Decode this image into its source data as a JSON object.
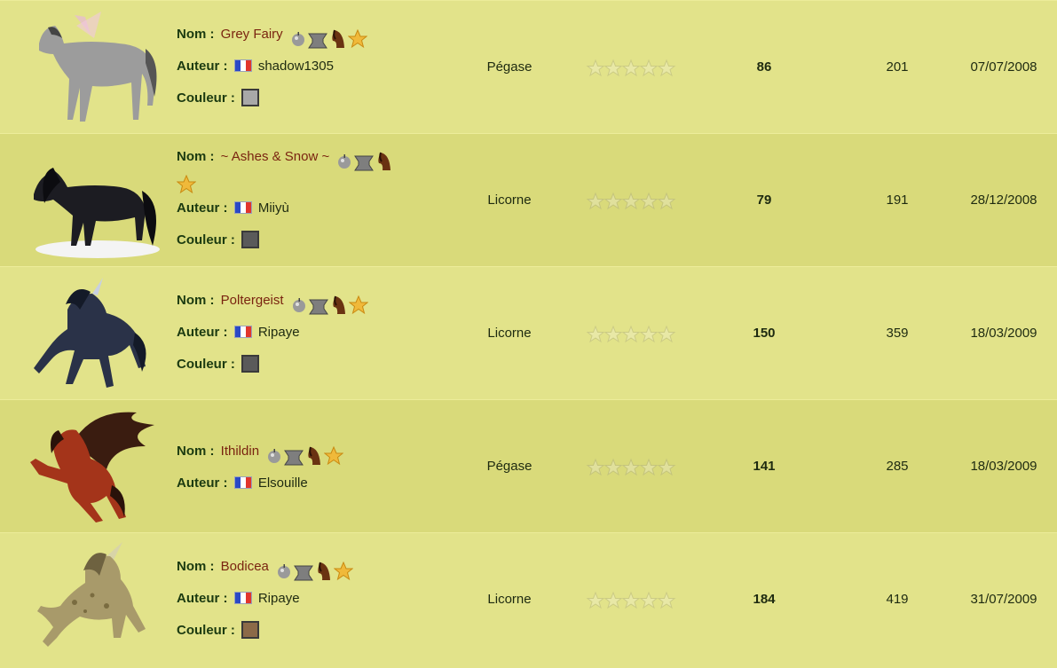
{
  "labels": {
    "name": "Nom :",
    "author": "Auteur :",
    "color": "Couleur :"
  },
  "badges": [
    "apple-icon",
    "anvil-icon",
    "horse-head-icon",
    "star-icon"
  ],
  "rating_icon": "empty-star-icon",
  "colors": {
    "name_text": "#7a2410",
    "label_text": "#1b3a10",
    "row_light": "#e2e38a",
    "row_dark": "#d9da7a"
  },
  "rows": [
    {
      "name": "Grey Fairy",
      "author": "shadow1305",
      "author_flag": "france-flag-icon",
      "color_swatch": "#a8a8a8",
      "type": "Pégase",
      "rating_stars": 0,
      "score": "86",
      "views": "201",
      "date": "07/07/2008",
      "image": "grey-fairy-horse-image"
    },
    {
      "name": "~ Ashes & Snow ~",
      "author": "Miiyù",
      "author_flag": "france-flag-icon",
      "color_swatch": "#5a5a5a",
      "type": "Licorne",
      "rating_stars": 0,
      "score": "79",
      "views": "191",
      "date": "28/12/2008",
      "image": "black-horse-on-snow-image"
    },
    {
      "name": "Poltergeist",
      "author": "Ripaye",
      "author_flag": "france-flag-icon",
      "color_swatch": "#5a5a5a",
      "type": "Licorne",
      "rating_stars": 0,
      "score": "150",
      "views": "359",
      "date": "18/03/2009",
      "image": "dark-blue-unicorn-image"
    },
    {
      "name": "Ithildin",
      "author": "Elsouille",
      "author_flag": "france-flag-icon",
      "type": "Pégase",
      "rating_stars": 0,
      "score": "141",
      "views": "285",
      "date": "18/03/2009",
      "image": "red-pegasus-image"
    },
    {
      "name": "Bodicea",
      "author": "Ripaye",
      "author_flag": "france-flag-icon",
      "color_swatch": "#8c6a48",
      "type": "Licorne",
      "rating_stars": 0,
      "score": "184",
      "views": "419",
      "date": "31/07/2009",
      "image": "golden-spotted-unicorn-image"
    }
  ]
}
